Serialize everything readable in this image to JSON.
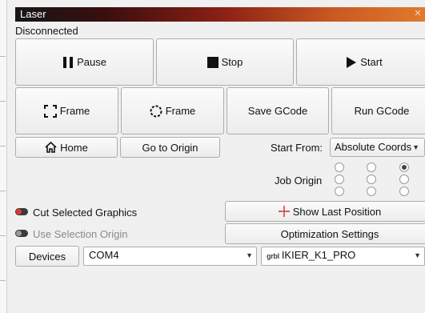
{
  "window": {
    "title": "Laser",
    "close_icon": "close-icon"
  },
  "status": {
    "text": "Disconnected"
  },
  "buttons": {
    "pause": "Pause",
    "stop": "Stop",
    "start": "Start",
    "frame_rect": "Frame",
    "frame_circle": "Frame",
    "save_gcode": "Save GCode",
    "run_gcode": "Run GCode",
    "home": "Home",
    "go_to_origin": "Go to Origin",
    "show_last_position": "Show Last Position",
    "optimization_settings": "Optimization Settings",
    "devices": "Devices"
  },
  "start_from": {
    "label": "Start From:",
    "value": "Absolute Coords"
  },
  "job_origin": {
    "label": "Job Origin",
    "selected_index": 2
  },
  "options": {
    "cut_selected_graphics": {
      "label": "Cut Selected Graphics",
      "enabled": true,
      "color": "#e23b2e"
    },
    "use_selection_origin": {
      "label": "Use Selection Origin",
      "enabled": false
    }
  },
  "port": {
    "value": "COM4"
  },
  "device": {
    "prefix": "grbl",
    "value": "IKIER_K1_PRO"
  }
}
